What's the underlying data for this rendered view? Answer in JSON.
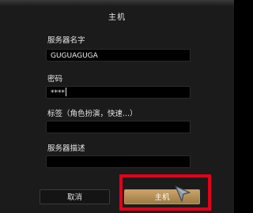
{
  "dialog": {
    "title": "主机"
  },
  "fields": {
    "server_name": {
      "label": "服务器名字",
      "value": "GUGUAGUGA"
    },
    "password": {
      "label": "密码",
      "value": "****"
    },
    "tags": {
      "label": "标签（角色扮演，快速...）",
      "value": ""
    },
    "description": {
      "label": "服务器描述",
      "value": ""
    }
  },
  "buttons": {
    "cancel_label": "取消",
    "host_label": "主机"
  },
  "colors": {
    "dialog_bg": "#1b1b1b",
    "field_bg": "#000000",
    "host_button": "#b89259",
    "highlight": "#e3001b"
  },
  "icons": {
    "pointer": "cursor-arrow-icon"
  }
}
